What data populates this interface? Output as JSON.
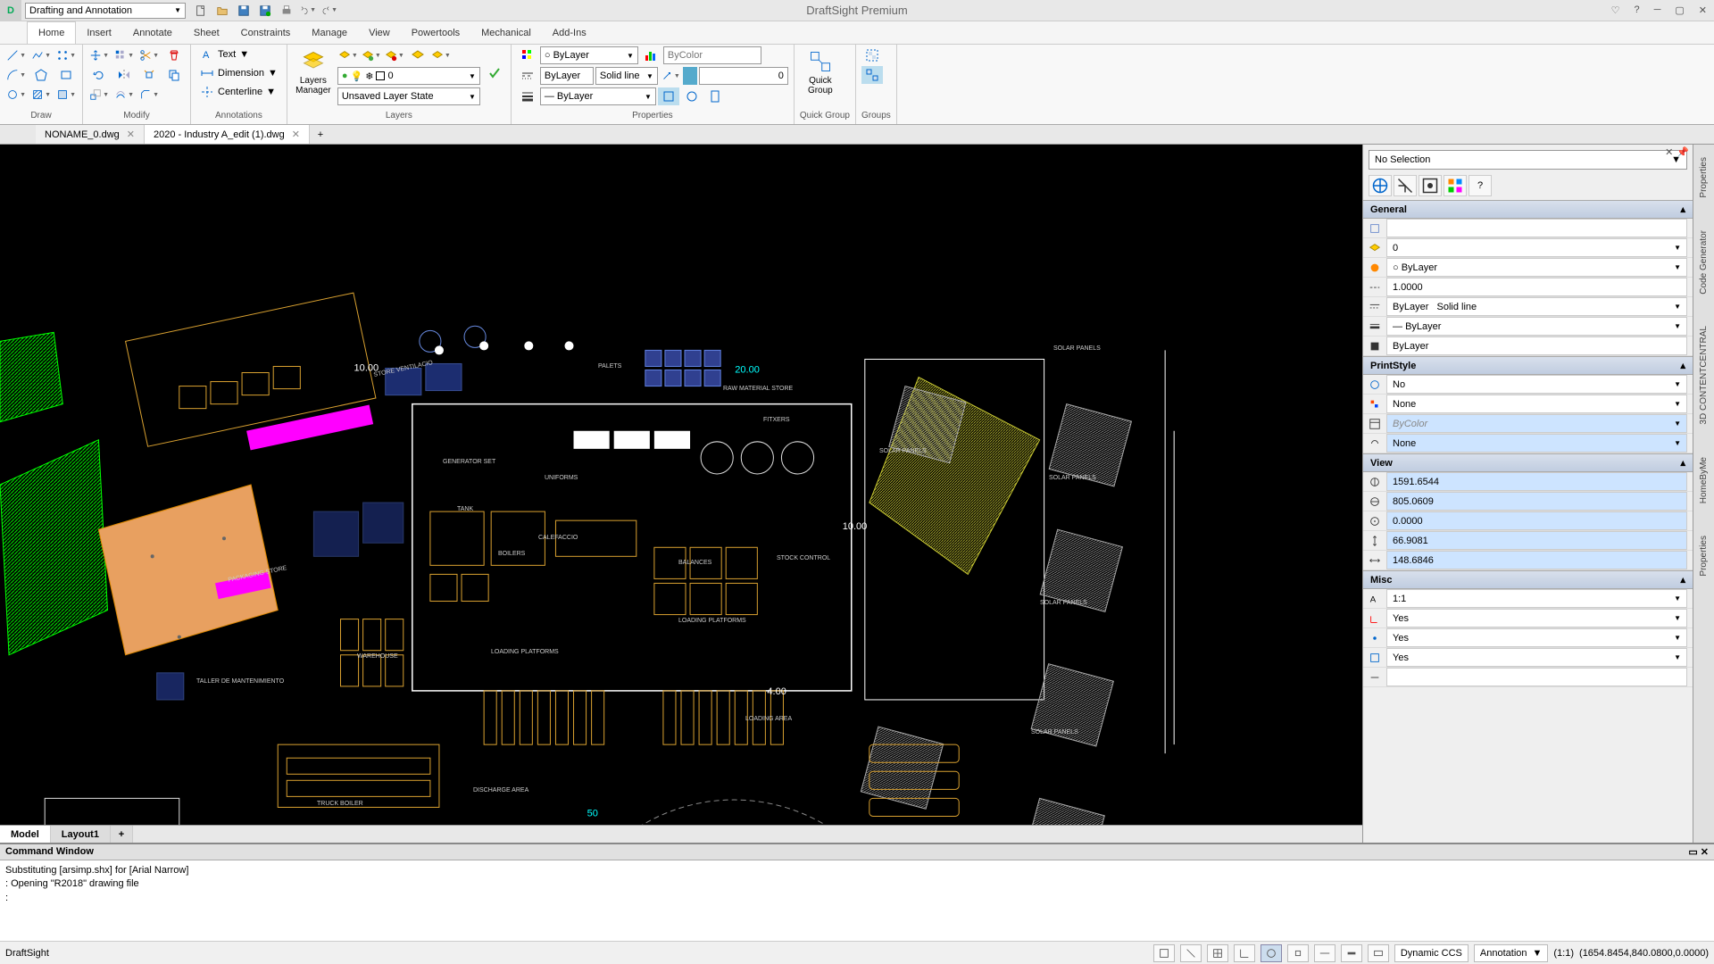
{
  "app": {
    "title": "DraftSight Premium",
    "workspace": "Drafting and Annotation"
  },
  "menus": [
    "Home",
    "Insert",
    "Annotate",
    "Sheet",
    "Constraints",
    "Manage",
    "View",
    "Powertools",
    "Mechanical",
    "Add-Ins"
  ],
  "ribbon": {
    "panels": [
      "Draw",
      "Modify",
      "Annotations",
      "Layers",
      "Properties",
      "Quick Group",
      "Groups"
    ],
    "annotations": {
      "text": "Text",
      "dimension": "Dimension",
      "centerline": "Centerline"
    },
    "layers_manager": "Layers\nManager",
    "layer_state": "Unsaved Layer State",
    "props": {
      "color": "ByLayer",
      "linetype1": "ByLayer",
      "linetype2": "Solid line",
      "lineweight": "ByLayer",
      "bycolor": "ByColor",
      "transparency": "0"
    },
    "quickgroup": "Quick\nGroup"
  },
  "doctabs": [
    {
      "name": "NONAME_0.dwg"
    },
    {
      "name": "2020 - Industry A_edit (1).dwg"
    }
  ],
  "sheet_tabs": [
    "Model",
    "Layout1"
  ],
  "properties": {
    "selection": "No Selection",
    "sections": {
      "General": {
        "layer": "0",
        "color": "ByLayer",
        "linescale": "1.0000",
        "linestyle_a": "ByLayer",
        "linestyle_b": "Solid line",
        "lineweight": "ByLayer",
        "material": "ByLayer"
      },
      "PrintStyle": {
        "plot": "No",
        "style": "None",
        "table": "ByColor",
        "attached": "None"
      },
      "View": {
        "center_x": "1591.6544",
        "center_y": "805.0609",
        "center_z": "0.0000",
        "height": "66.9081",
        "width": "148.6846"
      },
      "Misc": {
        "annoscale": "1:1",
        "ucs_icon": "Yes",
        "ucs_origin": "Yes",
        "ucs_vp": "Yes",
        "blank": ""
      }
    }
  },
  "right_tabs": [
    "Properties",
    "Code Generator",
    "3D CONTENTCENTRAL",
    "HomeByMe",
    "Properties"
  ],
  "cmd": {
    "title": "Command Window",
    "lines": [
      "Substituting [arsimp.shx] for [Arial Narrow]",
      ": Opening \"R2018\" drawing file",
      "",
      ":"
    ]
  },
  "status": {
    "left": "DraftSight",
    "dccs": "Dynamic CCS",
    "anno": "Annotation",
    "scale": "(1:1)",
    "coords": "(1654.8454,840.0800,0.0000)"
  },
  "drawing_labels": {
    "raw_material": "RAW MATERIAL STORE",
    "solar": "SOLAR PANELS",
    "loading": "LOADING AREA",
    "loading_platforms": "LOADING PLATFORMS",
    "warehouse": "WAREHOUSE",
    "truck": "TRUCK BOILER",
    "discharge": "DISCHARGE AREA",
    "taller": "TALLER DE MANTENIMIENTO",
    "pallets": "PALETS",
    "balances": "BALANCES",
    "stock": "STOCK CONTROL",
    "tank": "TANK",
    "packaging": "PACKAGING STORE",
    "fitxers": "FITXERS",
    "boilers": "BOILERS",
    "calefaccio": "CALEFACCIO",
    "generator": "GENERATOR SET",
    "ventilacio": "STORE VENTILACIO",
    "uniforms": "UNIFORMS"
  }
}
